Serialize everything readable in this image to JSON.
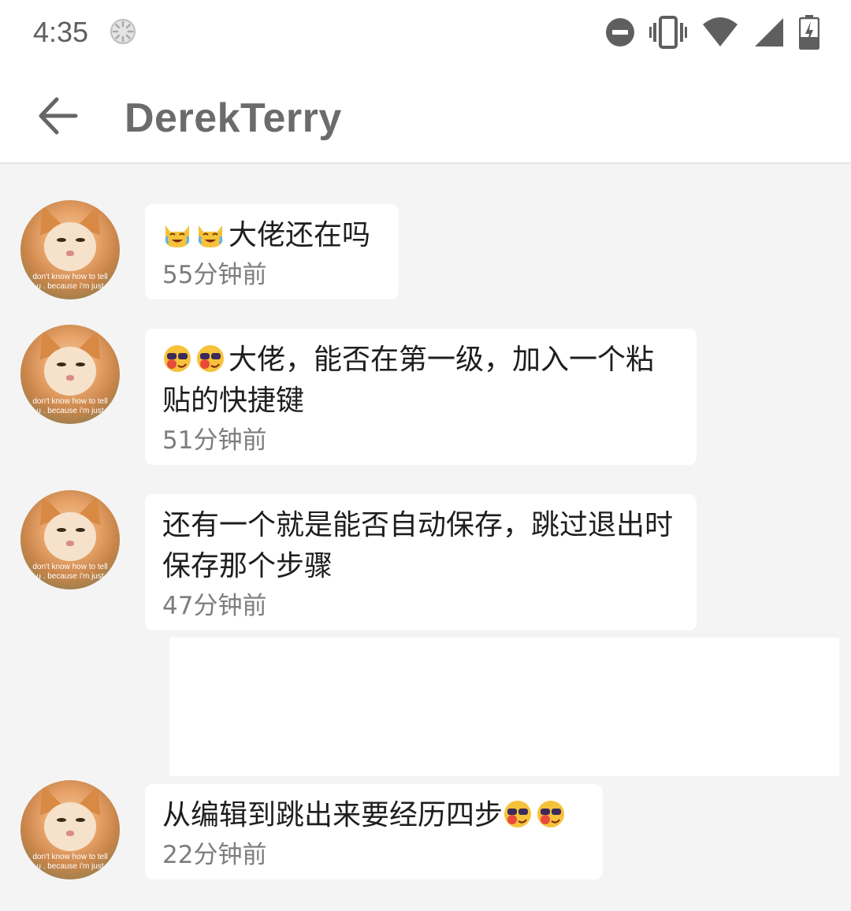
{
  "status_bar": {
    "time": "4:35",
    "icons": [
      "sync-icon",
      "do-not-disturb-icon",
      "vibrate-icon",
      "wifi-icon",
      "cellular-signal-icon",
      "battery-charging-icon"
    ]
  },
  "app_bar": {
    "title": "DerekTerry",
    "back_icon": "arrow-back-icon"
  },
  "messages": [
    {
      "emoji": [
        "crying-laughing-cat-emoji",
        "crying-laughing-cat-emoji"
      ],
      "text": "大佬还在吗",
      "time": "55分钟前"
    },
    {
      "emoji": [
        "sunglasses-wave-emoji",
        "sunglasses-wave-emoji"
      ],
      "text": "大佬，能否在第一级，加入一个粘贴的快捷键",
      "time": "51分钟前"
    },
    {
      "emoji": [],
      "text": "还有一个就是能否自动保存，跳过退出时保存那个步骤",
      "time": "47分钟前"
    },
    {
      "emoji_after": [
        "sunglasses-wave-emoji",
        "sunglasses-wave-emoji"
      ],
      "text": "从编辑到跳出来要经历四步",
      "time": "22分钟前"
    }
  ],
  "avatar_caption": [
    "don't know how to tell",
    "u . because i'm just"
  ],
  "colors": {
    "background": "#f4f4f4",
    "bubble": "#ffffff",
    "title": "#6b6b6b",
    "timestamp": "#7d7d7d"
  }
}
